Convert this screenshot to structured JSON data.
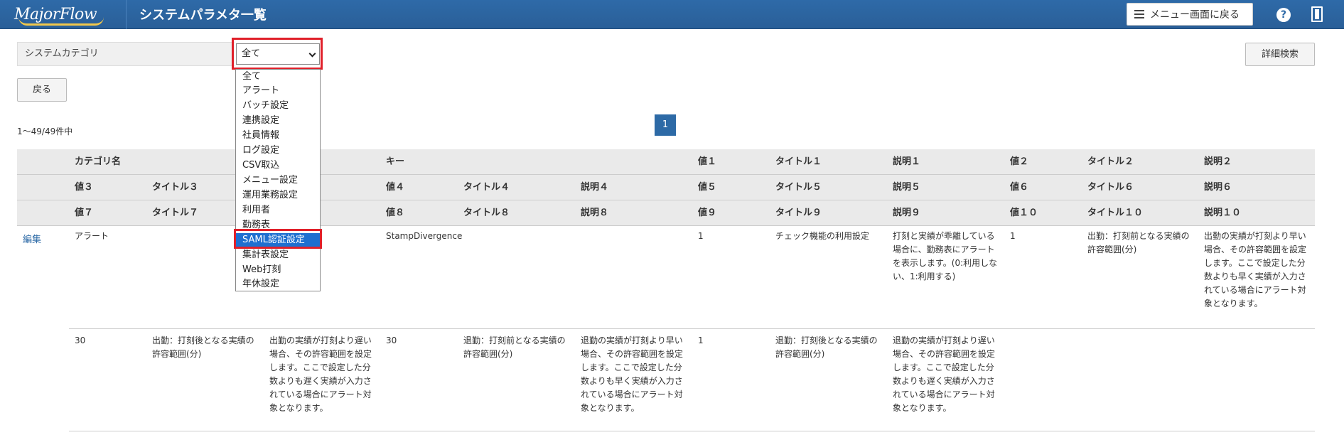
{
  "header": {
    "logo": "MajorFlow",
    "title": "システムパラメタ一覧",
    "menu_button": "メニュー画面に戻る",
    "help": "?"
  },
  "filter": {
    "category_label": "システムカテゴリ",
    "selected_value": "全て",
    "detail_search": "詳細検索",
    "back": "戻る"
  },
  "pagination": {
    "count_text": "1〜49/49件中",
    "current_page": "1"
  },
  "dropdown": {
    "options": [
      "全て",
      "アラート",
      "バッチ設定",
      "連携設定",
      "社員情報",
      "ログ設定",
      "CSV取込",
      "メニュー設定",
      "運用業務設定",
      "利用者",
      "勤務表",
      "SAML認証設定",
      "集計表設定",
      "Web打刻",
      "年休設定"
    ],
    "highlighted_index": 11
  },
  "table": {
    "header_row1": [
      "カテゴリ名",
      "キー",
      "値１",
      "タイトル１",
      "説明１",
      "値２",
      "タイトル２",
      "説明２"
    ],
    "header_row2": [
      "値３",
      "タイトル３",
      "値４",
      "タイトル４",
      "説明４",
      "値５",
      "タイトル５",
      "説明５",
      "値６",
      "タイトル６",
      "説明６"
    ],
    "header_row3": [
      "値７",
      "タイトル７",
      "値８",
      "タイトル８",
      "説明８",
      "値９",
      "タイトル９",
      "説明９",
      "値１０",
      "タイトル１０",
      "説明１０"
    ],
    "edit_link": "編集",
    "row1": {
      "category": "アラート",
      "key": "StampDivergence",
      "value1": "1",
      "title1": "チェック機能の利用設定",
      "desc1": "打刻と実績が乖離している場合に、勤務表にアラートを表示します。(0:利用しない、1:利用する)",
      "value2": "1",
      "title2": "出勤：打刻前となる実績の許容範囲(分)",
      "desc2": "出勤の実績が打刻より早い場合、その許容範囲を設定します。ここで設定した分数よりも早く実績が入力されている場合にアラート対象となります。"
    },
    "row2": {
      "value3": "30",
      "title3": "出勤：打刻後となる実績の許容範囲(分)",
      "desc3": "出勤の実績が打刻より遅い場合、その許容範囲を設定します。ここで設定した分数よりも遅く実績が入力されている場合にアラート対象となります。",
      "value4": "30",
      "title4": "退勤：打刻前となる実績の許容範囲(分)",
      "desc4": "退勤の実績が打刻より早い場合、その許容範囲を設定します。ここで設定した分数よりも早く実績が入力されている場合にアラート対象となります。",
      "value5": "1",
      "title5": "退勤：打刻後となる実績の許容範囲(分)",
      "desc5": "退勤の実績が打刻より遅い場合、その許容範囲を設定します。ここで設定した分数よりも遅く実績が入力されている場合にアラート対象となります。"
    }
  },
  "colors": {
    "header_bg": "#2e6aa8",
    "highlight_red": "#e0202a",
    "selected_blue": "#1e6fd0",
    "link_blue": "#2d6aa6"
  }
}
